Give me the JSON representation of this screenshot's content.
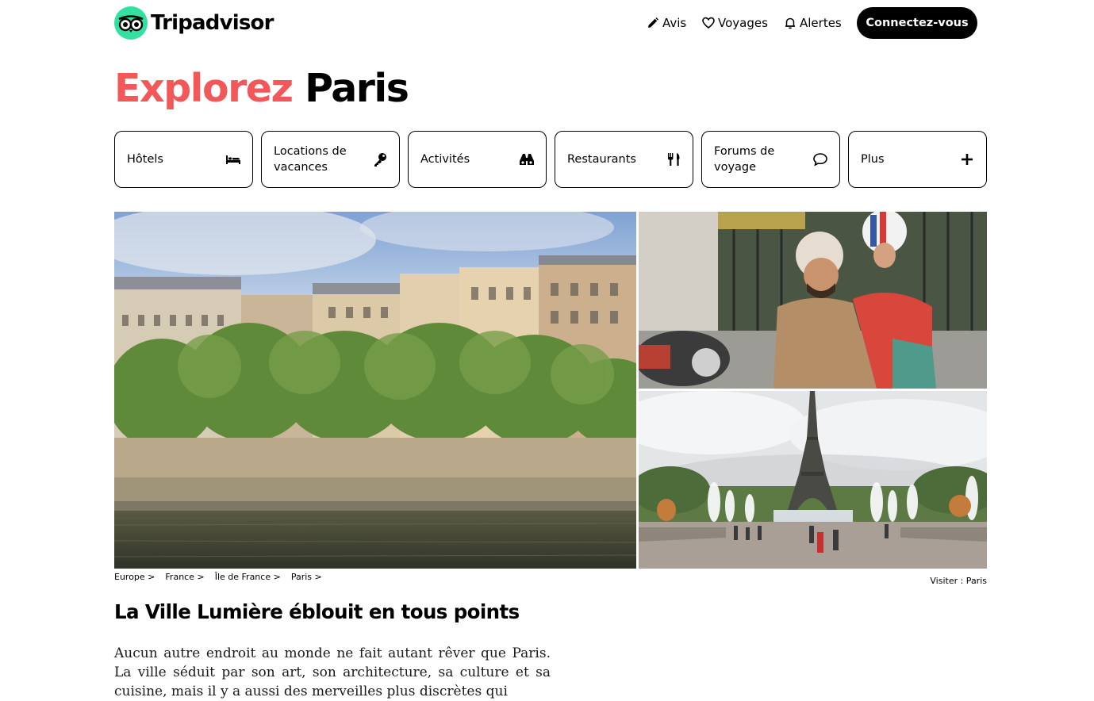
{
  "header": {
    "brand": "Tripadvisor",
    "nav": [
      {
        "label": "Avis",
        "icon": "pencil-icon"
      },
      {
        "label": "Voyages",
        "icon": "heart-icon"
      },
      {
        "label": "Alertes",
        "icon": "bell-icon"
      }
    ],
    "login_label": "Connectez-vous"
  },
  "page": {
    "title_highlight": "Explorez",
    "title_city": "Paris",
    "colors": {
      "accent": "#f2575a",
      "brand_green": "#34e0a1",
      "button": "#000000"
    }
  },
  "categories": [
    {
      "label": "Hôtels",
      "icon": "bed-icon"
    },
    {
      "label": "Locations de vacances",
      "icon": "key-icon"
    },
    {
      "label": "Activités",
      "icon": "binoculars-icon"
    },
    {
      "label": "Restaurants",
      "icon": "fork-knife-icon"
    },
    {
      "label": "Forums de voyage",
      "icon": "chat-bubble-icon"
    },
    {
      "label": "Plus",
      "icon": "plus-icon"
    }
  ],
  "breadcrumbs": [
    "Europe >",
    "France >",
    "Île de France >",
    "Paris >"
  ],
  "photo_credit": "Visiter : Paris",
  "article": {
    "heading": "La Ville Lumière éblouit en tous points",
    "body": "Aucun autre endroit au monde ne fait autant rêver que Paris. La ville séduit par son art, son architecture, sa culture et sa cuisine, mais il y a aussi des merveilles plus discrètes qui"
  }
}
